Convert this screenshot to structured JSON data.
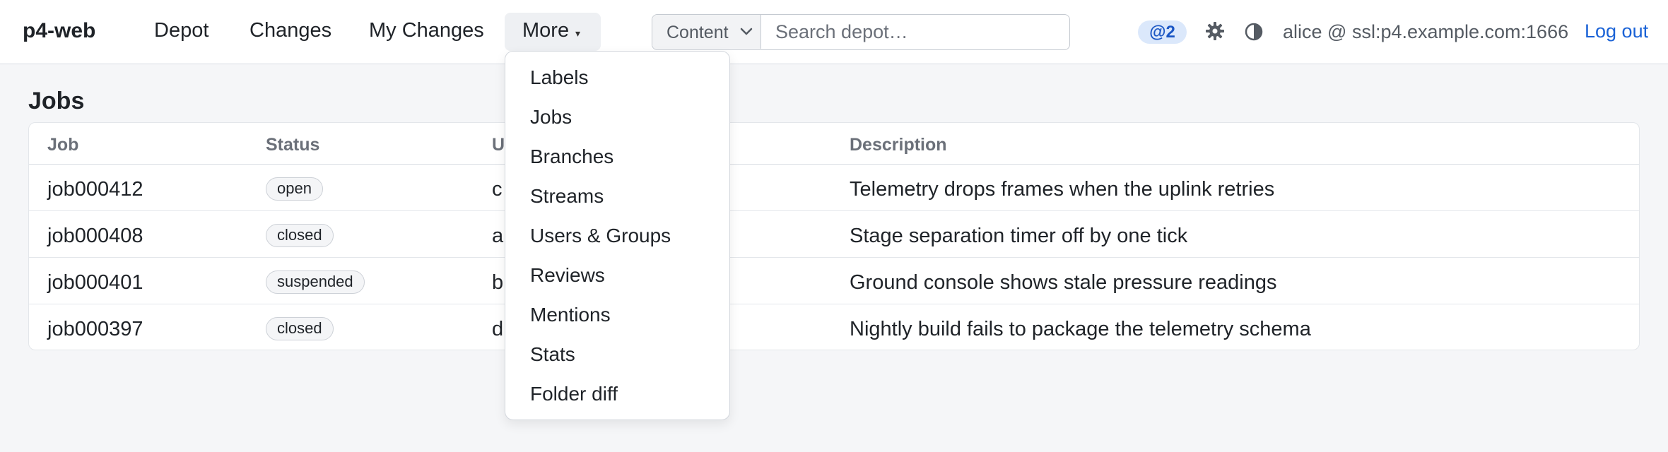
{
  "app": {
    "title": "p4-web"
  },
  "nav": {
    "depot": "Depot",
    "changes": "Changes",
    "my_changes": "My Changes",
    "more": "More",
    "more_caret": "▾"
  },
  "search": {
    "scope": "Content",
    "placeholder": "Search depot…",
    "value": ""
  },
  "header": {
    "mentions_badge": "@2",
    "settings_icon": "gear-icon",
    "theme_icon": "contrast-icon",
    "user": "alice @ ssl:p4.example.com:1666",
    "logout": "Log out"
  },
  "page": {
    "title": "Jobs"
  },
  "table": {
    "columns": [
      "Job",
      "Status",
      "U",
      "Description"
    ],
    "rows": [
      {
        "job": "job000412",
        "status": "open",
        "user": "c",
        "description": "Telemetry drops frames when the uplink retries"
      },
      {
        "job": "job000408",
        "status": "closed",
        "user": "a",
        "description": "Stage separation timer off by one tick"
      },
      {
        "job": "job000401",
        "status": "suspended",
        "user": "b",
        "description": "Ground console shows stale pressure readings"
      },
      {
        "job": "job000397",
        "status": "closed",
        "user": "d",
        "description": "Nightly build fails to package the telemetry schema"
      }
    ]
  },
  "more_menu": {
    "items": [
      "Labels",
      "Jobs",
      "Branches",
      "Streams",
      "Users & Groups",
      "Reviews",
      "Mentions",
      "Stats",
      "Folder diff"
    ]
  },
  "colors": {
    "accent": "#1a62d6",
    "badge_bg": "#dbe8fb",
    "background": "#f5f6f8"
  }
}
